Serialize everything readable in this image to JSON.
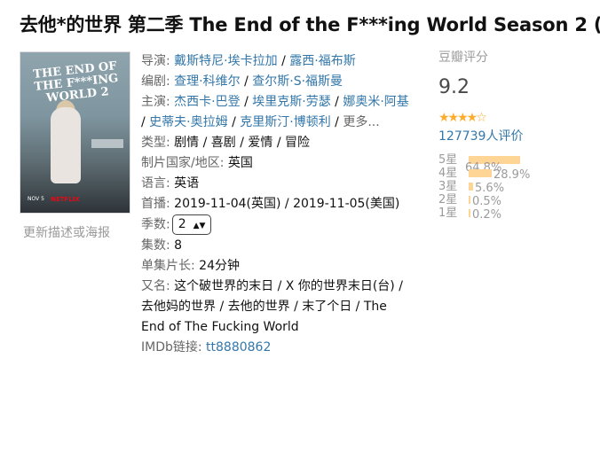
{
  "title": "去他*的世界 第二季 The End of the F***ing World Season 2 (",
  "poster": {
    "title_text": "THE END OF THE F***ING WORLD 2",
    "date": "NOV 5",
    "brand": "NETFLIX"
  },
  "update_link": "更新描述或海报",
  "info": {
    "director_label": "导演:",
    "directors": [
      "戴斯特尼·埃卡拉加",
      "露西·福布斯"
    ],
    "writer_label": "编剧:",
    "writers": [
      "查理·科维尔",
      "查尔斯·S·福斯曼"
    ],
    "cast_label": "主演:",
    "cast": [
      "杰西卡·巴登",
      "埃里克斯·劳瑟",
      "娜奥米·阿基",
      "史蒂夫·奥拉姆",
      "克里斯汀·博顿利"
    ],
    "more": "更多...",
    "genre_label": "类型:",
    "genre": "剧情 / 喜剧 / 爱情 / 冒险",
    "country_label": "制片国家/地区:",
    "country": "英国",
    "language_label": "语言:",
    "language": "英语",
    "premiere_label": "首播:",
    "premiere": "2019-11-04(英国) / 2019-11-05(美国)",
    "season_label": "季数:",
    "season_value": "2",
    "episodes_label": "集数:",
    "episodes": "8",
    "runtime_label": "单集片长:",
    "runtime": "24分钟",
    "aka_label": "又名:",
    "aka": "这个破世界的末日 / X 你的世界末日(台) / 去他妈的世界 / 去他的世界 / 末了个日 / The End of The Fucking World",
    "imdb_label": "IMDb链接:",
    "imdb": "tt8880862"
  },
  "rating": {
    "label": "豆瓣评分",
    "score": "9.2",
    "stars_value": 4.5,
    "votes": "127739人评价",
    "distribution": [
      {
        "label": "5星",
        "percent": 64.8,
        "text": "64.8%"
      },
      {
        "label": "4星",
        "percent": 28.9,
        "text": "28.9%"
      },
      {
        "label": "3星",
        "percent": 5.6,
        "text": "5.6%"
      },
      {
        "label": "2星",
        "percent": 0.5,
        "text": "0.5%"
      },
      {
        "label": "1星",
        "percent": 0.2,
        "text": "0.2%"
      }
    ],
    "bar_color": "#ffd596"
  },
  "colors": {
    "link": "#3377aa",
    "muted": "#666666",
    "star": "#ffac2d"
  }
}
